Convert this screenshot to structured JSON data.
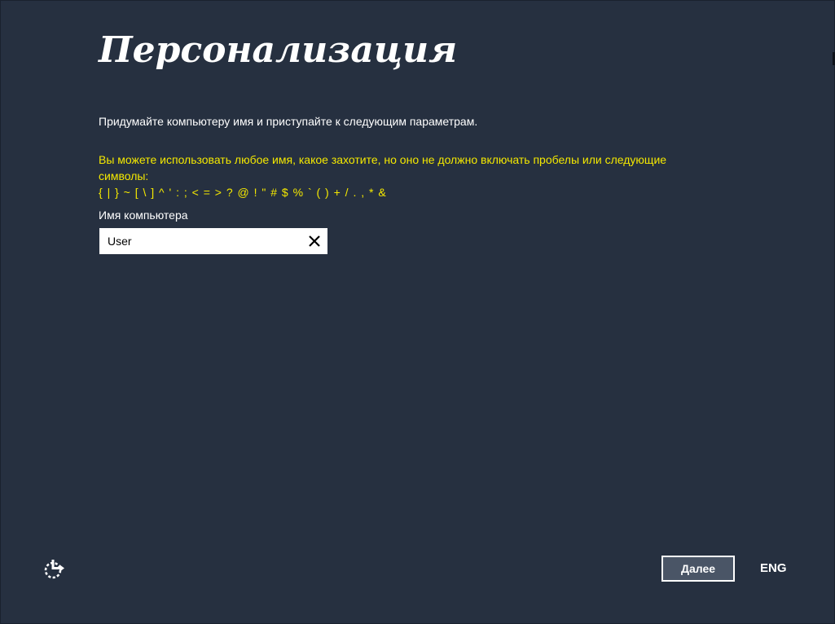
{
  "page": {
    "title": "Персонализация",
    "intro": "Придумайте компьютеру имя и приступайте к следующим параметрам.",
    "warning_text": "Вы можете использовать любое имя, какое захотите, но оно не должно включать пробелы или следующие символы:",
    "forbidden_chars": "{ | } ~ [ \\ ] ^ ' : ; < = > ? @ ! \" # $ % ` ( ) + / . , * &"
  },
  "form": {
    "computer_name_label": "Имя компьютера",
    "computer_name_value": "User",
    "clear_icon": "close-icon"
  },
  "footer": {
    "accessibility_icon": "ease-of-access-icon",
    "next_label": "Далее",
    "language_label": "ENG"
  },
  "colors": {
    "background": "#263040",
    "warning_text": "#f4e800",
    "button_fill": "#4a5566",
    "input_background": "#ffffff"
  }
}
